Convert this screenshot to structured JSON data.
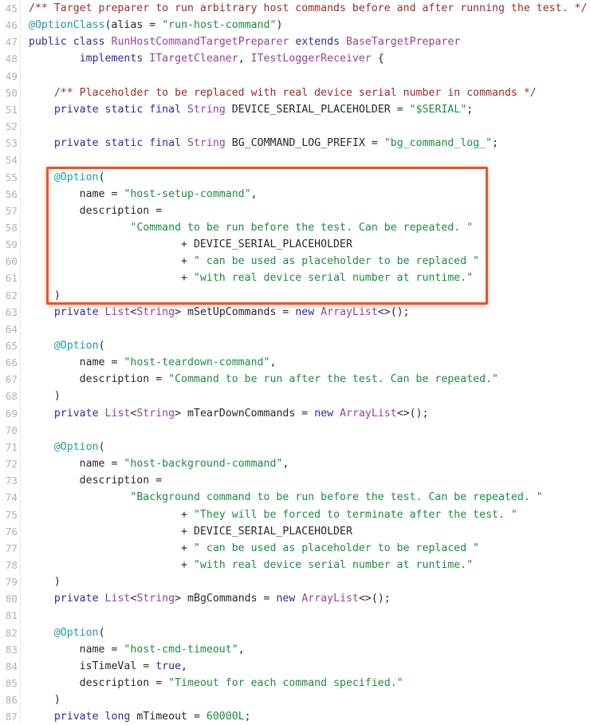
{
  "viewer": {
    "type": "source-code-viewer",
    "language": "Java",
    "first_line_number": 45,
    "last_line_number": 87,
    "background_color": "#ffffff",
    "gutter_color": "#b0b2b8"
  },
  "annotation": {
    "shape": "rectangle",
    "color": "#f4501e",
    "covers_lines": "55-62",
    "label": "highlighted-option-block"
  },
  "theme": {
    "comment": "#a02b2b",
    "annotation": "#1f9e9e",
    "keyword": "#2c2ca8",
    "type": "#9b3f9b",
    "string": "#1a8f3c",
    "number": "#1a8f3c",
    "plain": "#24292e"
  },
  "lines": [
    {
      "n": "45",
      "tokens": [
        {
          "c": "cm",
          "t": "/** Target preparer to run arbitrary host commands before and after running the test. */"
        }
      ]
    },
    {
      "n": "46",
      "tokens": [
        {
          "c": "an",
          "t": "@OptionClass"
        },
        {
          "c": "pl",
          "t": "("
        },
        {
          "c": "pl",
          "t": "alias"
        },
        {
          "c": "pl",
          "t": " = "
        },
        {
          "c": "st",
          "t": "\"run-host-command\""
        },
        {
          "c": "pl",
          "t": ")"
        }
      ]
    },
    {
      "n": "47",
      "tokens": [
        {
          "c": "kw",
          "t": "public"
        },
        {
          "c": "pl",
          "t": " "
        },
        {
          "c": "kw",
          "t": "class"
        },
        {
          "c": "pl",
          "t": " "
        },
        {
          "c": "ty",
          "t": "RunHostCommandTargetPreparer"
        },
        {
          "c": "pl",
          "t": " "
        },
        {
          "c": "kw",
          "t": "extends"
        },
        {
          "c": "pl",
          "t": " "
        },
        {
          "c": "ty",
          "t": "BaseTargetPreparer"
        }
      ]
    },
    {
      "n": "48",
      "tokens": [
        {
          "c": "pl",
          "t": "        "
        },
        {
          "c": "kw",
          "t": "implements"
        },
        {
          "c": "pl",
          "t": " "
        },
        {
          "c": "ty",
          "t": "ITargetCleaner"
        },
        {
          "c": "pl",
          "t": ", "
        },
        {
          "c": "ty",
          "t": "ITestLoggerReceiver"
        },
        {
          "c": "pl",
          "t": " {"
        }
      ]
    },
    {
      "n": "49",
      "tokens": []
    },
    {
      "n": "50",
      "tokens": [
        {
          "c": "pl",
          "t": "    "
        },
        {
          "c": "cm",
          "t": "/** Placeholder to be replaced with real device serial number in commands */"
        }
      ]
    },
    {
      "n": "51",
      "tokens": [
        {
          "c": "pl",
          "t": "    "
        },
        {
          "c": "kw",
          "t": "private"
        },
        {
          "c": "pl",
          "t": " "
        },
        {
          "c": "kw",
          "t": "static"
        },
        {
          "c": "pl",
          "t": " "
        },
        {
          "c": "kw",
          "t": "final"
        },
        {
          "c": "pl",
          "t": " "
        },
        {
          "c": "ty",
          "t": "String"
        },
        {
          "c": "pl",
          "t": " DEVICE_SERIAL_PLACEHOLDER = "
        },
        {
          "c": "st",
          "t": "\"$SERIAL\""
        },
        {
          "c": "pl",
          "t": ";"
        }
      ]
    },
    {
      "n": "52",
      "tokens": []
    },
    {
      "n": "53",
      "tokens": [
        {
          "c": "pl",
          "t": "    "
        },
        {
          "c": "kw",
          "t": "private"
        },
        {
          "c": "pl",
          "t": " "
        },
        {
          "c": "kw",
          "t": "static"
        },
        {
          "c": "pl",
          "t": " "
        },
        {
          "c": "kw",
          "t": "final"
        },
        {
          "c": "pl",
          "t": " "
        },
        {
          "c": "ty",
          "t": "String"
        },
        {
          "c": "pl",
          "t": " BG_COMMAND_LOG_PREFIX = "
        },
        {
          "c": "st",
          "t": "\"bg_command_log_\""
        },
        {
          "c": "pl",
          "t": ";"
        }
      ]
    },
    {
      "n": "54",
      "tokens": []
    },
    {
      "n": "55",
      "tokens": [
        {
          "c": "pl",
          "t": "    "
        },
        {
          "c": "an",
          "t": "@Option"
        },
        {
          "c": "pl",
          "t": "("
        }
      ]
    },
    {
      "n": "56",
      "tokens": [
        {
          "c": "pl",
          "t": "        name = "
        },
        {
          "c": "st",
          "t": "\"host-setup-command\""
        },
        {
          "c": "pl",
          "t": ","
        }
      ]
    },
    {
      "n": "57",
      "tokens": [
        {
          "c": "pl",
          "t": "        description ="
        }
      ]
    },
    {
      "n": "58",
      "tokens": [
        {
          "c": "pl",
          "t": "                "
        },
        {
          "c": "st",
          "t": "\"Command to be run before the test. Can be repeated. \""
        }
      ]
    },
    {
      "n": "59",
      "tokens": [
        {
          "c": "pl",
          "t": "                        + DEVICE_SERIAL_PLACEHOLDER"
        }
      ]
    },
    {
      "n": "60",
      "tokens": [
        {
          "c": "pl",
          "t": "                        + "
        },
        {
          "c": "st",
          "t": "\" can be used as placeholder to be replaced \""
        }
      ]
    },
    {
      "n": "61",
      "tokens": [
        {
          "c": "pl",
          "t": "                        + "
        },
        {
          "c": "st",
          "t": "\"with real device serial number at runtime.\""
        }
      ]
    },
    {
      "n": "62",
      "tokens": [
        {
          "c": "pl",
          "t": "    )"
        }
      ]
    },
    {
      "n": "63",
      "tokens": [
        {
          "c": "pl",
          "t": "    "
        },
        {
          "c": "kw",
          "t": "private"
        },
        {
          "c": "pl",
          "t": " "
        },
        {
          "c": "ty",
          "t": "List"
        },
        {
          "c": "pl",
          "t": "<"
        },
        {
          "c": "ty",
          "t": "String"
        },
        {
          "c": "pl",
          "t": "> mSetUpCommands = "
        },
        {
          "c": "kw",
          "t": "new"
        },
        {
          "c": "pl",
          "t": " "
        },
        {
          "c": "ty",
          "t": "ArrayList"
        },
        {
          "c": "pl",
          "t": "<>();"
        }
      ]
    },
    {
      "n": "64",
      "tokens": []
    },
    {
      "n": "65",
      "tokens": [
        {
          "c": "pl",
          "t": "    "
        },
        {
          "c": "an",
          "t": "@Option"
        },
        {
          "c": "pl",
          "t": "("
        }
      ]
    },
    {
      "n": "66",
      "tokens": [
        {
          "c": "pl",
          "t": "        name = "
        },
        {
          "c": "st",
          "t": "\"host-teardown-command\""
        },
        {
          "c": "pl",
          "t": ","
        }
      ]
    },
    {
      "n": "67",
      "tokens": [
        {
          "c": "pl",
          "t": "        description = "
        },
        {
          "c": "st",
          "t": "\"Command to be run after the test. Can be repeated.\""
        }
      ]
    },
    {
      "n": "68",
      "tokens": [
        {
          "c": "pl",
          "t": "    )"
        }
      ]
    },
    {
      "n": "69",
      "tokens": [
        {
          "c": "pl",
          "t": "    "
        },
        {
          "c": "kw",
          "t": "private"
        },
        {
          "c": "pl",
          "t": " "
        },
        {
          "c": "ty",
          "t": "List"
        },
        {
          "c": "pl",
          "t": "<"
        },
        {
          "c": "ty",
          "t": "String"
        },
        {
          "c": "pl",
          "t": "> mTearDownCommands = "
        },
        {
          "c": "kw",
          "t": "new"
        },
        {
          "c": "pl",
          "t": " "
        },
        {
          "c": "ty",
          "t": "ArrayList"
        },
        {
          "c": "pl",
          "t": "<>();"
        }
      ]
    },
    {
      "n": "70",
      "tokens": []
    },
    {
      "n": "71",
      "tokens": [
        {
          "c": "pl",
          "t": "    "
        },
        {
          "c": "an",
          "t": "@Option"
        },
        {
          "c": "pl",
          "t": "("
        }
      ]
    },
    {
      "n": "72",
      "tokens": [
        {
          "c": "pl",
          "t": "        name = "
        },
        {
          "c": "st",
          "t": "\"host-background-command\""
        },
        {
          "c": "pl",
          "t": ","
        }
      ]
    },
    {
      "n": "73",
      "tokens": [
        {
          "c": "pl",
          "t": "        description ="
        }
      ]
    },
    {
      "n": "74",
      "tokens": [
        {
          "c": "pl",
          "t": "                "
        },
        {
          "c": "st",
          "t": "\"Background command to be run before the test. Can be repeated. \""
        }
      ]
    },
    {
      "n": "75",
      "tokens": [
        {
          "c": "pl",
          "t": "                        + "
        },
        {
          "c": "st",
          "t": "\"They will be forced to terminate after the test. \""
        }
      ]
    },
    {
      "n": "76",
      "tokens": [
        {
          "c": "pl",
          "t": "                        + DEVICE_SERIAL_PLACEHOLDER"
        }
      ]
    },
    {
      "n": "77",
      "tokens": [
        {
          "c": "pl",
          "t": "                        + "
        },
        {
          "c": "st",
          "t": "\" can be used as placeholder to be replaced \""
        }
      ]
    },
    {
      "n": "78",
      "tokens": [
        {
          "c": "pl",
          "t": "                        + "
        },
        {
          "c": "st",
          "t": "\"with real device serial number at runtime.\""
        }
      ]
    },
    {
      "n": "79",
      "tokens": [
        {
          "c": "pl",
          "t": "    )"
        }
      ]
    },
    {
      "n": "80",
      "tokens": [
        {
          "c": "pl",
          "t": "    "
        },
        {
          "c": "kw",
          "t": "private"
        },
        {
          "c": "pl",
          "t": " "
        },
        {
          "c": "ty",
          "t": "List"
        },
        {
          "c": "pl",
          "t": "<"
        },
        {
          "c": "ty",
          "t": "String"
        },
        {
          "c": "pl",
          "t": "> mBgCommands = "
        },
        {
          "c": "kw",
          "t": "new"
        },
        {
          "c": "pl",
          "t": " "
        },
        {
          "c": "ty",
          "t": "ArrayList"
        },
        {
          "c": "pl",
          "t": "<>();"
        }
      ]
    },
    {
      "n": "81",
      "tokens": []
    },
    {
      "n": "82",
      "tokens": [
        {
          "c": "pl",
          "t": "    "
        },
        {
          "c": "an",
          "t": "@Option"
        },
        {
          "c": "pl",
          "t": "("
        }
      ]
    },
    {
      "n": "83",
      "tokens": [
        {
          "c": "pl",
          "t": "        name = "
        },
        {
          "c": "st",
          "t": "\"host-cmd-timeout\""
        },
        {
          "c": "pl",
          "t": ","
        }
      ]
    },
    {
      "n": "84",
      "tokens": [
        {
          "c": "pl",
          "t": "        isTimeVal = "
        },
        {
          "c": "bl",
          "t": "true"
        },
        {
          "c": "pl",
          "t": ","
        }
      ]
    },
    {
      "n": "85",
      "tokens": [
        {
          "c": "pl",
          "t": "        description = "
        },
        {
          "c": "st",
          "t": "\"Timeout for each command specified.\""
        }
      ]
    },
    {
      "n": "86",
      "tokens": [
        {
          "c": "pl",
          "t": "    )"
        }
      ]
    },
    {
      "n": "87",
      "tokens": [
        {
          "c": "pl",
          "t": "    "
        },
        {
          "c": "kw",
          "t": "private"
        },
        {
          "c": "pl",
          "t": " "
        },
        {
          "c": "kw",
          "t": "long"
        },
        {
          "c": "pl",
          "t": " mTimeout = "
        },
        {
          "c": "nu",
          "t": "60000L"
        },
        {
          "c": "pl",
          "t": ";"
        }
      ]
    }
  ]
}
